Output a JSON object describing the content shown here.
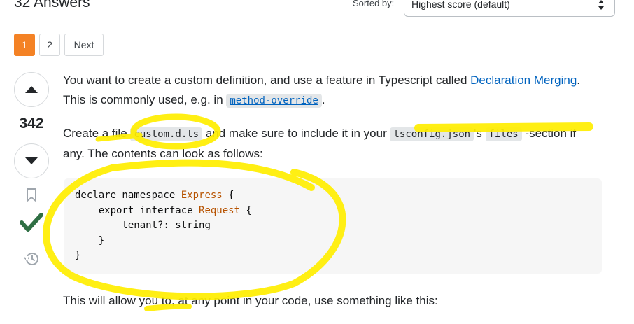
{
  "header": {
    "answers_count": "32 Answers",
    "sorted_label": "Sorted by:",
    "sort_value": "Highest score (default)"
  },
  "pagination": {
    "pages": [
      "1",
      "2"
    ],
    "next_label": "Next",
    "current": 1
  },
  "vote": {
    "score": "342",
    "accepted": true
  },
  "answer": {
    "p1": {
      "t1": "You want to create a custom definition, and use a feature in Typescript called ",
      "link": "Declaration Merging",
      "t2": ". This is commonly used, e.g. in ",
      "code_link": "method-override",
      "t3": "."
    },
    "p2": {
      "t1": "Create a file ",
      "code1": "custom.d.ts",
      "t2": " and make sure to include it in your ",
      "code2": "tsconfig.json",
      "t3": "'s ",
      "code3": "files",
      "t4": " -section if any. The contents can look as follows:"
    },
    "code_block": {
      "line1_kw": "declare namespace",
      "line1_name": "Express",
      "line1_end": " {",
      "line2_kw": "export interface",
      "line2_name": "Request",
      "line2_end": " {",
      "line3": "tenant?: string",
      "line4": "}",
      "line5": "}"
    },
    "p3": "This will allow you to, at any point in your code, use something like this:"
  },
  "icons": {
    "up": "arrow-up-icon",
    "down": "arrow-down-icon",
    "bookmark": "bookmark-icon",
    "accepted": "check-icon",
    "history": "history-icon",
    "sort_caret": "sort-caret-icon"
  },
  "colors": {
    "accent": "#f48225",
    "link": "#0063bf",
    "accepted": "#2f6f44",
    "highlight": "#ffee00"
  }
}
